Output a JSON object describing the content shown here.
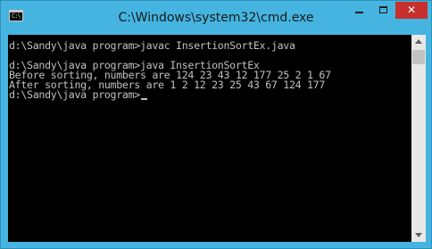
{
  "window": {
    "title": "C:\\Windows\\system32\\cmd.exe",
    "icon": "cmd-icon",
    "controls": {
      "minimize_icon": "minimize-icon",
      "maximize_icon": "maximize-icon",
      "close_symbol": "✕"
    }
  },
  "console": {
    "lines": [
      "d:\\Sandy\\java program>javac InsertionSortEx.java",
      "",
      "d:\\Sandy\\java program>java InsertionSortEx",
      "Before sorting, numbers are 124 23 43 12 177 25 2 1 67",
      "After sorting, numbers are 1 2 12 23 25 43 67 124 177",
      "d:\\Sandy\\java program>"
    ]
  },
  "colors": {
    "frame": "#45b4e0",
    "console_bg": "#000000",
    "console_text": "#c0c0c0",
    "close_button": "#c7302c"
  }
}
